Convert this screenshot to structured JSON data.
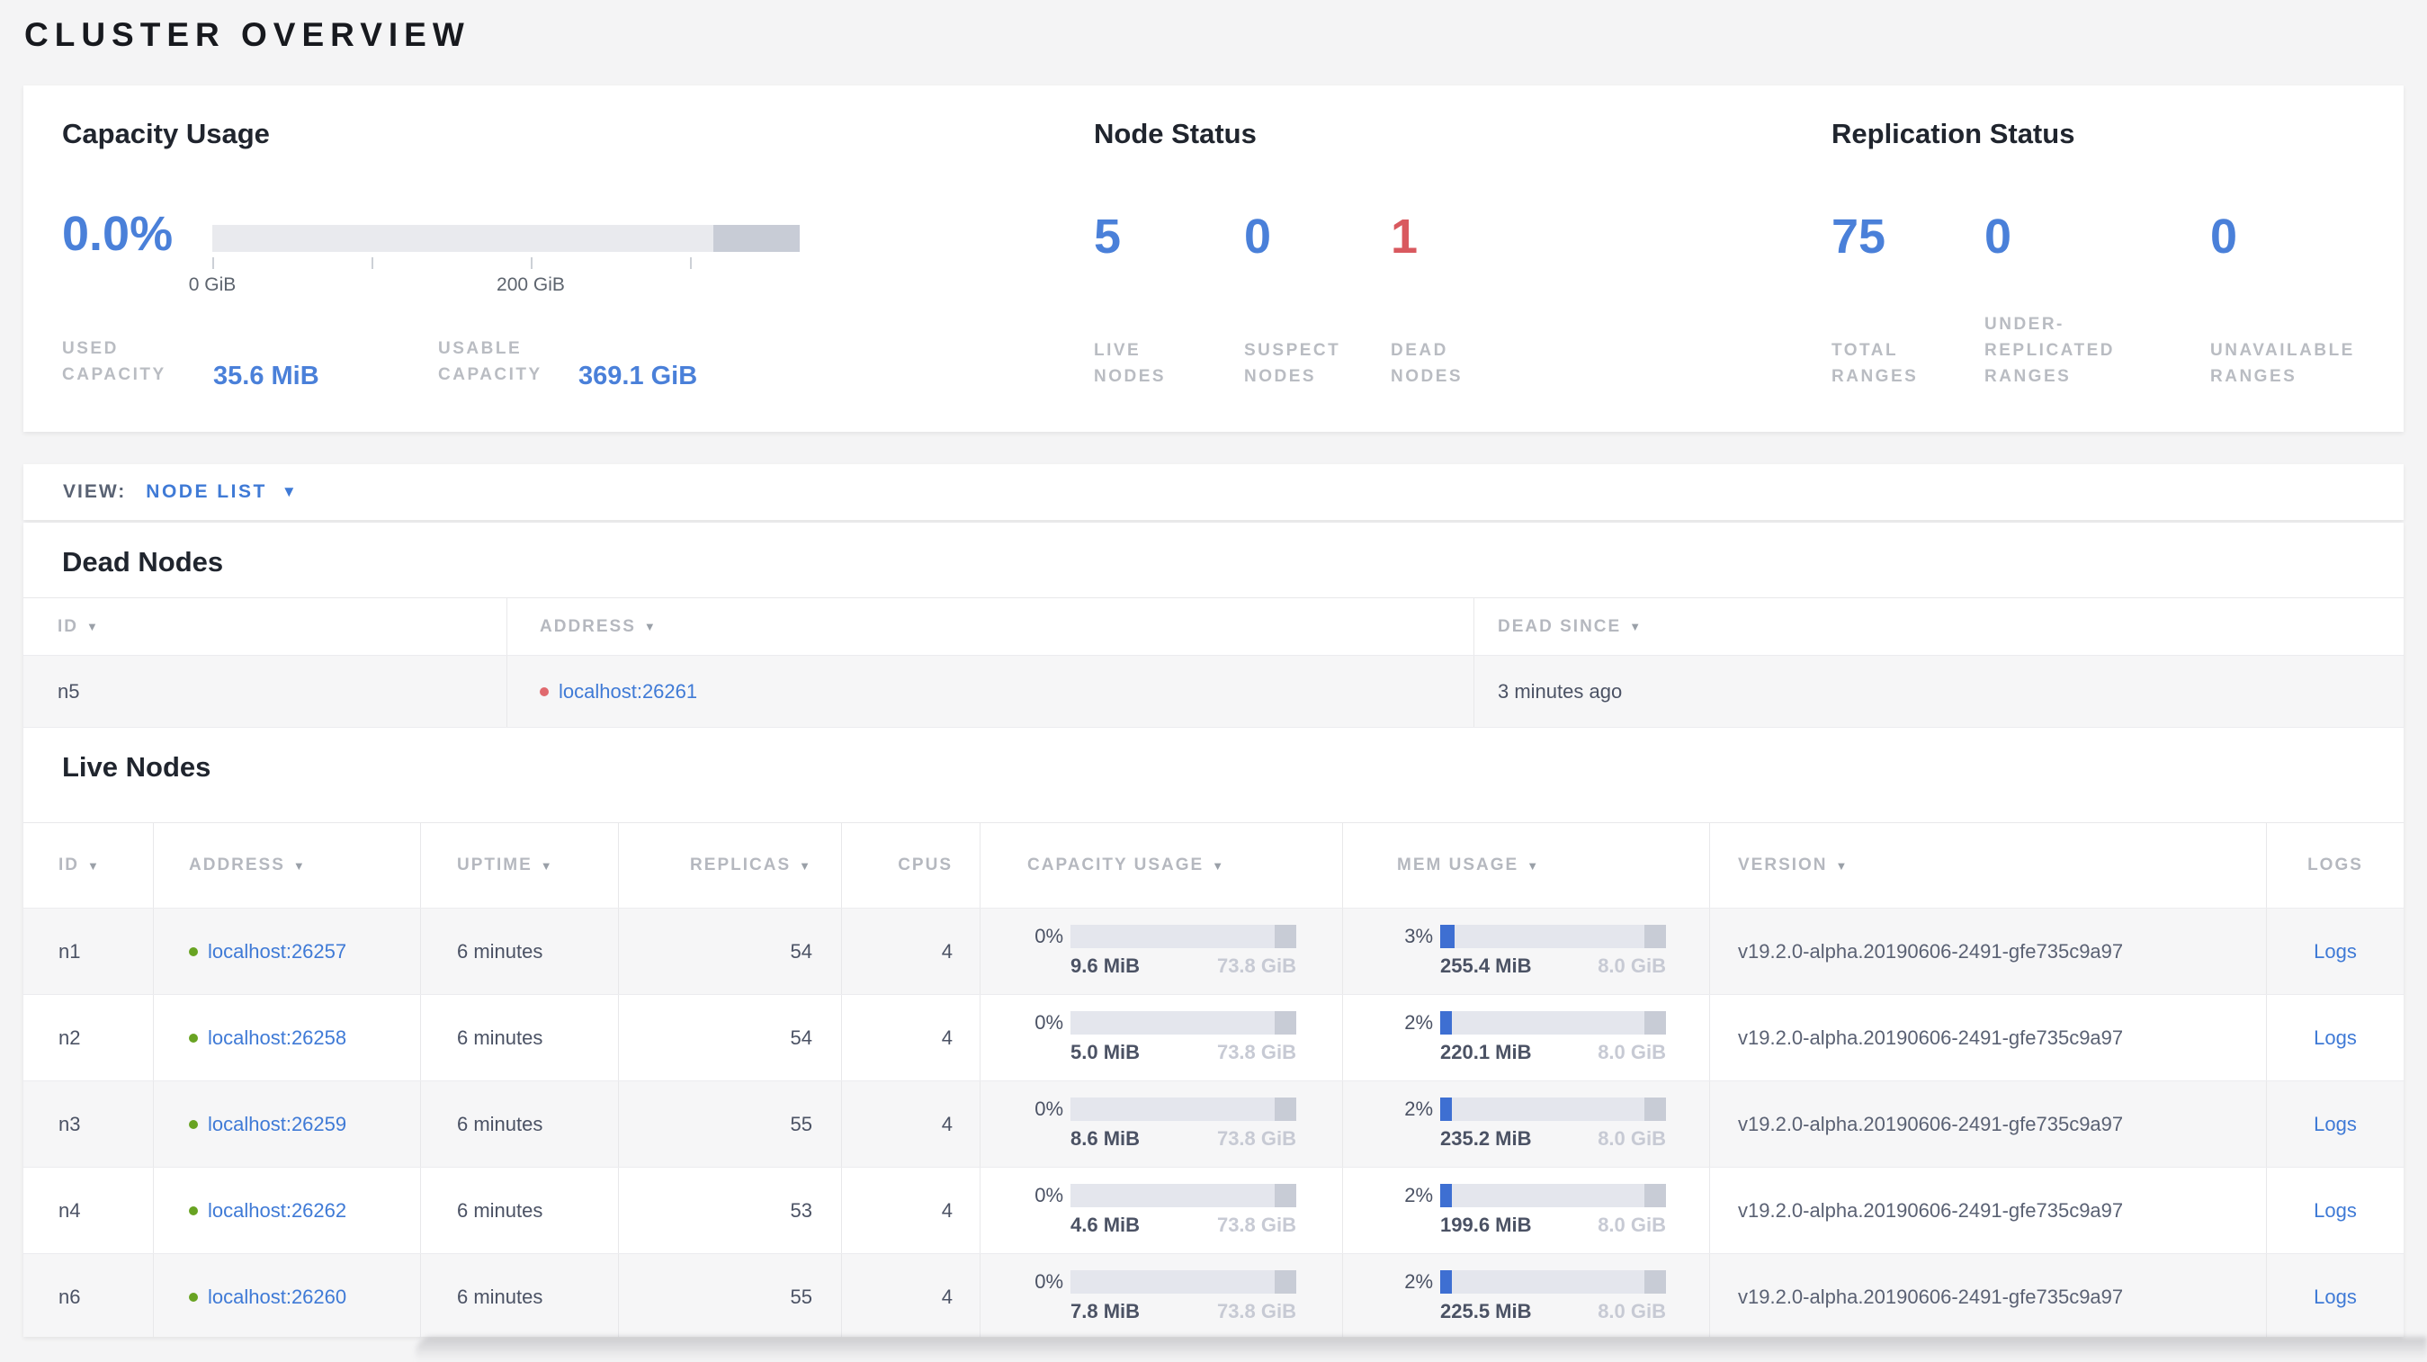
{
  "page_title": "CLUSTER OVERVIEW",
  "glyphs": {
    "sort": "▼",
    "caret": "▼"
  },
  "summary": {
    "capacity": {
      "title": "Capacity Usage",
      "percent_big": "0.0%",
      "bar": {
        "reserved_fraction": 0.147,
        "tick_labels": [
          "0 GiB",
          "200 GiB"
        ]
      },
      "stats": [
        {
          "label": "USED\nCAPACITY",
          "value": "35.6 MiB"
        },
        {
          "label": "USABLE\nCAPACITY",
          "value": "369.1 GiB"
        }
      ]
    },
    "node_status": {
      "title": "Node Status",
      "metrics": [
        {
          "value": "5",
          "label": "LIVE\nNODES",
          "tone": "blue"
        },
        {
          "value": "0",
          "label": "SUSPECT\nNODES",
          "tone": "blue"
        },
        {
          "value": "1",
          "label": "DEAD\nNODES",
          "tone": "red"
        }
      ]
    },
    "replication_status": {
      "title": "Replication Status",
      "metrics": [
        {
          "value": "75",
          "label": "TOTAL\nRANGES",
          "tone": "blue"
        },
        {
          "value": "0",
          "label": "UNDER-\nREPLICATED\nRANGES",
          "tone": "blue"
        },
        {
          "value": "0",
          "label": "UNAVAILABLE\nRANGES",
          "tone": "blue"
        }
      ]
    }
  },
  "view_bar": {
    "label": "VIEW:",
    "selected": "NODE LIST"
  },
  "dead_nodes": {
    "title": "Dead Nodes",
    "columns": [
      {
        "label": "ID",
        "sortable": true
      },
      {
        "label": "ADDRESS",
        "sortable": true
      },
      {
        "label": "DEAD SINCE",
        "sortable": true
      }
    ],
    "rows": [
      {
        "id": "n5",
        "address": "localhost:26261",
        "dead_since": "3 minutes ago"
      }
    ]
  },
  "live_nodes": {
    "title": "Live Nodes",
    "logs_label": "Logs",
    "columns": [
      {
        "label": "ID",
        "sortable": true
      },
      {
        "label": "ADDRESS",
        "sortable": true
      },
      {
        "label": "UPTIME",
        "sortable": true
      },
      {
        "label": "REPLICAS",
        "sortable": true
      },
      {
        "label": "CPUS",
        "sortable": false
      },
      {
        "label": "CAPACITY USAGE",
        "sortable": true
      },
      {
        "label": "MEM USAGE",
        "sortable": true
      },
      {
        "label": "VERSION",
        "sortable": true
      },
      {
        "label": "LOGS",
        "sortable": false
      }
    ],
    "rows": [
      {
        "id": "n1",
        "address": "localhost:26257",
        "uptime": "6 minutes",
        "replicas": "54",
        "cpus": "4",
        "capacity": {
          "percent": "0%",
          "percent_num": 0,
          "used": "9.6 MiB",
          "total": "73.8 GiB"
        },
        "memory": {
          "percent": "3%",
          "percent_num": 3,
          "used": "255.4 MiB",
          "total": "8.0 GiB"
        },
        "version": "v19.2.0-alpha.20190606-2491-gfe735c9a97"
      },
      {
        "id": "n2",
        "address": "localhost:26258",
        "uptime": "6 minutes",
        "replicas": "54",
        "cpus": "4",
        "capacity": {
          "percent": "0%",
          "percent_num": 0,
          "used": "5.0 MiB",
          "total": "73.8 GiB"
        },
        "memory": {
          "percent": "2%",
          "percent_num": 2,
          "used": "220.1 MiB",
          "total": "8.0 GiB"
        },
        "version": "v19.2.0-alpha.20190606-2491-gfe735c9a97"
      },
      {
        "id": "n3",
        "address": "localhost:26259",
        "uptime": "6 minutes",
        "replicas": "55",
        "cpus": "4",
        "capacity": {
          "percent": "0%",
          "percent_num": 0,
          "used": "8.6 MiB",
          "total": "73.8 GiB"
        },
        "memory": {
          "percent": "2%",
          "percent_num": 2,
          "used": "235.2 MiB",
          "total": "8.0 GiB"
        },
        "version": "v19.2.0-alpha.20190606-2491-gfe735c9a97"
      },
      {
        "id": "n4",
        "address": "localhost:26262",
        "uptime": "6 minutes",
        "replicas": "53",
        "cpus": "4",
        "capacity": {
          "percent": "0%",
          "percent_num": 0,
          "used": "4.6 MiB",
          "total": "73.8 GiB"
        },
        "memory": {
          "percent": "2%",
          "percent_num": 2,
          "used": "199.6 MiB",
          "total": "8.0 GiB"
        },
        "version": "v19.2.0-alpha.20190606-2491-gfe735c9a97"
      },
      {
        "id": "n6",
        "address": "localhost:26260",
        "uptime": "6 minutes",
        "replicas": "55",
        "cpus": "4",
        "capacity": {
          "percent": "0%",
          "percent_num": 0,
          "used": "7.8 MiB",
          "total": "73.8 GiB"
        },
        "memory": {
          "percent": "2%",
          "percent_num": 2,
          "used": "225.5 MiB",
          "total": "8.0 GiB"
        },
        "version": "v19.2.0-alpha.20190606-2491-gfe735c9a97"
      }
    ]
  },
  "colors": {
    "accent_blue": "#4a80d9",
    "link_blue": "#3f7ad6",
    "danger_red": "#d9595f",
    "green_dot": "#68a322",
    "red_dot": "#e0696e",
    "bar_bg": "#e4e6ed",
    "bar_reserved": "#c8ccd6",
    "mem_fill": "#3e6fd2"
  }
}
